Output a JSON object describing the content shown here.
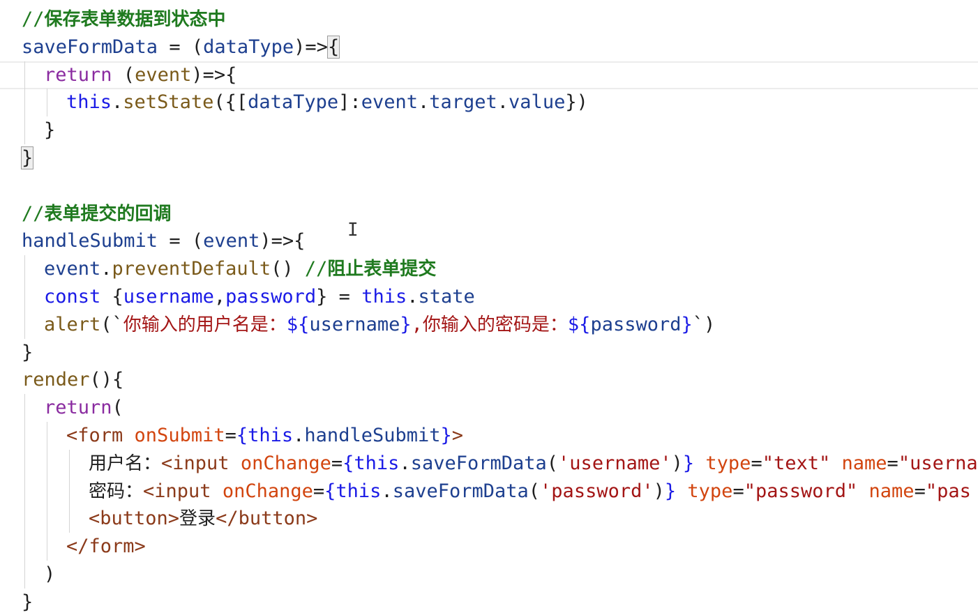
{
  "editor": {
    "lines": [
      {
        "indent": 0,
        "tokens": [
          {
            "t": "//",
            "c": "comment"
          },
          {
            "t": "保存表单数据到状态中",
            "c": "comment-cn"
          }
        ]
      },
      {
        "indent": 0,
        "tokens": [
          {
            "t": "saveFormData",
            "c": "fn"
          },
          {
            "t": " = (",
            "c": "punc"
          },
          {
            "t": "dataType",
            "c": "fn"
          },
          {
            "t": ")=>",
            "c": "punc"
          },
          {
            "t": "{",
            "c": "punc",
            "hl": true
          }
        ]
      },
      {
        "indent": 1,
        "current": true,
        "tokens": [
          {
            "t": "return",
            "c": "kw"
          },
          {
            "t": " (",
            "c": "punc"
          },
          {
            "t": "event",
            "c": "method"
          },
          {
            "t": ")=>{",
            "c": "punc"
          }
        ]
      },
      {
        "indent": 2,
        "tokens": [
          {
            "t": "this",
            "c": "blue"
          },
          {
            "t": ".",
            "c": "punc"
          },
          {
            "t": "setState",
            "c": "method"
          },
          {
            "t": "({[",
            "c": "punc"
          },
          {
            "t": "dataType",
            "c": "fn"
          },
          {
            "t": "]:",
            "c": "punc"
          },
          {
            "t": "event",
            "c": "fn"
          },
          {
            "t": ".",
            "c": "punc"
          },
          {
            "t": "target",
            "c": "fn"
          },
          {
            "t": ".",
            "c": "punc"
          },
          {
            "t": "value",
            "c": "fn"
          },
          {
            "t": "})",
            "c": "punc"
          }
        ]
      },
      {
        "indent": 1,
        "tokens": [
          {
            "t": "}",
            "c": "punc"
          }
        ]
      },
      {
        "indent": 0,
        "tokens": [
          {
            "t": "}",
            "c": "punc",
            "hl": true
          }
        ]
      },
      {
        "indent": 0,
        "tokens": []
      },
      {
        "indent": 0,
        "tokens": [
          {
            "t": "//",
            "c": "comment"
          },
          {
            "t": "表单提交的回调",
            "c": "comment-cn"
          }
        ]
      },
      {
        "indent": 0,
        "tokens": [
          {
            "t": "handleSubmit",
            "c": "fn"
          },
          {
            "t": " = (",
            "c": "punc"
          },
          {
            "t": "event",
            "c": "fn"
          },
          {
            "t": ")=>{",
            "c": "punc"
          }
        ]
      },
      {
        "indent": 1,
        "tokens": [
          {
            "t": "event",
            "c": "fn"
          },
          {
            "t": ".",
            "c": "punc"
          },
          {
            "t": "preventDefault",
            "c": "method"
          },
          {
            "t": "() ",
            "c": "punc"
          },
          {
            "t": "//",
            "c": "comment"
          },
          {
            "t": "阻止表单提交",
            "c": "comment-cn"
          }
        ]
      },
      {
        "indent": 1,
        "tokens": [
          {
            "t": "const",
            "c": "blue"
          },
          {
            "t": " {",
            "c": "punc"
          },
          {
            "t": "username",
            "c": "blue"
          },
          {
            "t": ",",
            "c": "punc"
          },
          {
            "t": "password",
            "c": "blue"
          },
          {
            "t": "} = ",
            "c": "punc"
          },
          {
            "t": "this",
            "c": "blue"
          },
          {
            "t": ".",
            "c": "punc"
          },
          {
            "t": "state",
            "c": "fn"
          }
        ]
      },
      {
        "indent": 1,
        "tokens": [
          {
            "t": "alert",
            "c": "method"
          },
          {
            "t": "(`",
            "c": "punc"
          },
          {
            "t": "你输入的用户名是：",
            "c": "str-cn"
          },
          {
            "t": "${",
            "c": "blue"
          },
          {
            "t": "username",
            "c": "fn"
          },
          {
            "t": "}",
            "c": "blue"
          },
          {
            "t": ",",
            "c": "str"
          },
          {
            "t": "你输入的密码是：",
            "c": "str-cn"
          },
          {
            "t": "${",
            "c": "blue"
          },
          {
            "t": "password",
            "c": "fn"
          },
          {
            "t": "}",
            "c": "blue"
          },
          {
            "t": "`)",
            "c": "punc"
          }
        ]
      },
      {
        "indent": 0,
        "tokens": [
          {
            "t": "}",
            "c": "punc"
          }
        ]
      },
      {
        "indent": 0,
        "tokens": [
          {
            "t": "render",
            "c": "method"
          },
          {
            "t": "(){",
            "c": "punc"
          }
        ]
      },
      {
        "indent": 1,
        "tokens": [
          {
            "t": "return",
            "c": "kw"
          },
          {
            "t": "(",
            "c": "punc"
          }
        ]
      },
      {
        "indent": 2,
        "tokens": [
          {
            "t": "<form",
            "c": "tag"
          },
          {
            "t": " ",
            "c": "punc"
          },
          {
            "t": "onSubmit",
            "c": "attr"
          },
          {
            "t": "=",
            "c": "punc"
          },
          {
            "t": "{",
            "c": "blue"
          },
          {
            "t": "this",
            "c": "blue"
          },
          {
            "t": ".",
            "c": "punc"
          },
          {
            "t": "handleSubmit",
            "c": "fn"
          },
          {
            "t": "}",
            "c": "blue"
          },
          {
            "t": ">",
            "c": "tag"
          }
        ]
      },
      {
        "indent": 3,
        "tokens": [
          {
            "t": "用户名：",
            "c": "cn"
          },
          {
            "t": "<input",
            "c": "tag"
          },
          {
            "t": " ",
            "c": "punc"
          },
          {
            "t": "onChange",
            "c": "attr"
          },
          {
            "t": "=",
            "c": "punc"
          },
          {
            "t": "{",
            "c": "blue"
          },
          {
            "t": "this",
            "c": "blue"
          },
          {
            "t": ".",
            "c": "punc"
          },
          {
            "t": "saveFormData",
            "c": "fn"
          },
          {
            "t": "(",
            "c": "punc"
          },
          {
            "t": "'username'",
            "c": "str"
          },
          {
            "t": ")",
            "c": "punc"
          },
          {
            "t": "}",
            "c": "blue"
          },
          {
            "t": " ",
            "c": "punc"
          },
          {
            "t": "type",
            "c": "attr"
          },
          {
            "t": "=",
            "c": "punc"
          },
          {
            "t": "\"text\"",
            "c": "str"
          },
          {
            "t": " ",
            "c": "punc"
          },
          {
            "t": "name",
            "c": "attr"
          },
          {
            "t": "=",
            "c": "punc"
          },
          {
            "t": "\"userna",
            "c": "str"
          }
        ]
      },
      {
        "indent": 3,
        "tokens": [
          {
            "t": "密码：",
            "c": "cn"
          },
          {
            "t": "<input",
            "c": "tag"
          },
          {
            "t": " ",
            "c": "punc"
          },
          {
            "t": "onChange",
            "c": "attr"
          },
          {
            "t": "=",
            "c": "punc"
          },
          {
            "t": "{",
            "c": "blue"
          },
          {
            "t": "this",
            "c": "blue"
          },
          {
            "t": ".",
            "c": "punc"
          },
          {
            "t": "saveFormData",
            "c": "fn"
          },
          {
            "t": "(",
            "c": "punc"
          },
          {
            "t": "'password'",
            "c": "str"
          },
          {
            "t": ")",
            "c": "punc"
          },
          {
            "t": "}",
            "c": "blue"
          },
          {
            "t": " ",
            "c": "punc"
          },
          {
            "t": "type",
            "c": "attr"
          },
          {
            "t": "=",
            "c": "punc"
          },
          {
            "t": "\"password\"",
            "c": "str"
          },
          {
            "t": " ",
            "c": "punc"
          },
          {
            "t": "name",
            "c": "attr"
          },
          {
            "t": "=",
            "c": "punc"
          },
          {
            "t": "\"pas",
            "c": "str"
          }
        ]
      },
      {
        "indent": 3,
        "tokens": [
          {
            "t": "<button>",
            "c": "tag"
          },
          {
            "t": "登录",
            "c": "cn"
          },
          {
            "t": "</button>",
            "c": "tag"
          }
        ]
      },
      {
        "indent": 2,
        "tokens": [
          {
            "t": "</form>",
            "c": "tag"
          }
        ]
      },
      {
        "indent": 1,
        "tokens": [
          {
            "t": ")",
            "c": "punc"
          }
        ]
      },
      {
        "indent": 0,
        "tokens": [
          {
            "t": "}",
            "c": "punc"
          }
        ]
      }
    ]
  }
}
